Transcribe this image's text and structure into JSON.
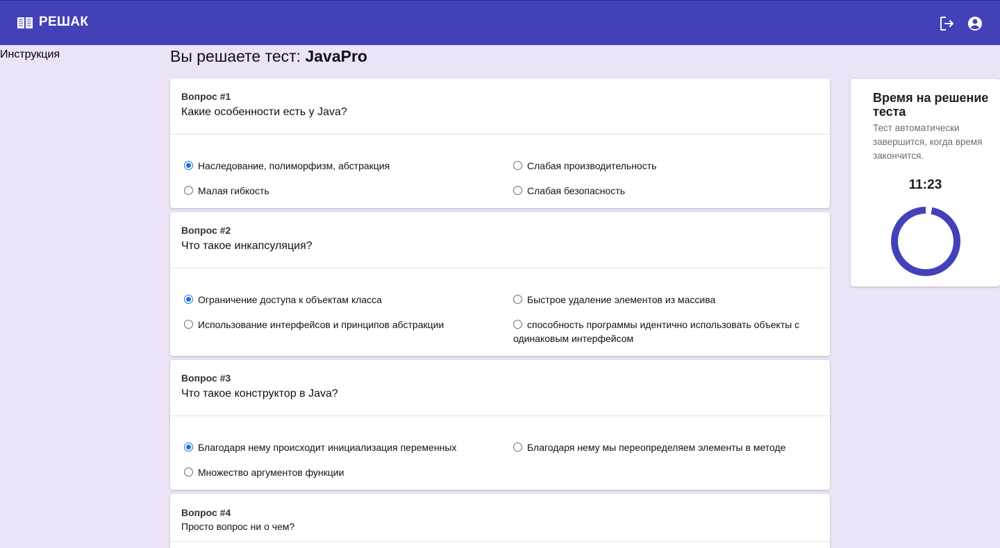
{
  "header": {
    "brand": "РЕШАК",
    "brand_icon": "book-icon",
    "logout_icon": "logout-icon",
    "account_icon": "account-circle-icon",
    "color": "#4341b8"
  },
  "sidebar": {
    "instruction_link": "Инструкция"
  },
  "page": {
    "title_prefix": "Вы решаете тест:",
    "test_name": "JavaPro"
  },
  "questions": [
    {
      "number": "Вопрос #1",
      "text": "Какие особенности есть у Java?",
      "options": [
        "Наследование, полиморфизм, абстракция",
        "Слабая производительность",
        "Малая гибкость",
        "Слабая безопасность"
      ],
      "selected": 0
    },
    {
      "number": "Вопрос #2",
      "text": "Что такое инкапсуляция?",
      "options": [
        "Ограничение доступа к объектам класса",
        "Быстрое удаление элементов из массива",
        "Использование интерфейсов и принципов абстракции",
        "способность программы идентично использовать объекты с одинаковым интерфейсом"
      ],
      "selected": 0
    },
    {
      "number": "Вопрос #3",
      "text": "Что такое конструктор в Java?",
      "options": [
        "Благодаря нему происходит инициализация переменных",
        "Благодаря нему мы переопределяем элементы в методе",
        "Множество аргументов функции"
      ],
      "selected": 0
    },
    {
      "number": "Вопрос #4",
      "text": "Просто вопрос ни о чем?",
      "options": [],
      "selected": null
    }
  ],
  "timer": {
    "title": "Время на решение теста",
    "subtitle": "Тест автоматически завершится, когда время закончится.",
    "time": "11:23",
    "remaining_fraction": 0.97,
    "ring_color": "#4341b8"
  }
}
